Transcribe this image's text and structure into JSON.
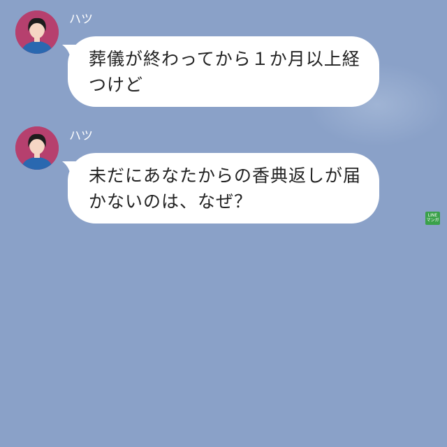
{
  "chat": {
    "messages": [
      {
        "sender": "ハツ",
        "lines": [
          "葬儀が終わってから１か月以上経",
          "つけど"
        ]
      },
      {
        "sender": "ハツ",
        "lines": [
          "未だにあなたからの香典返しが届",
          "かないのは、なぜ？"
        ]
      }
    ]
  },
  "badge": {
    "line1": "LINE",
    "line2": "マンガ"
  },
  "colors": {
    "background": "#8aa1c8",
    "bubble": "#ffffff",
    "avatar_bg": "#b6406e",
    "badge": "#3aa14a"
  }
}
